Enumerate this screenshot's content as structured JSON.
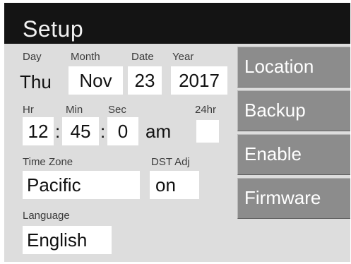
{
  "title": "Setup",
  "date": {
    "day_label": "Day",
    "month_label": "Month",
    "date_label": "Date",
    "year_label": "Year",
    "day": "Thu",
    "month": "Nov",
    "date": "23",
    "year": "2017"
  },
  "time": {
    "hr_label": "Hr",
    "min_label": "Min",
    "sec_label": "Sec",
    "h24_label": "24hr",
    "hr": "12",
    "min": "45",
    "sec": "0",
    "ampm": "am",
    "separator": ":",
    "h24_enabled": false
  },
  "timezone": {
    "label": "Time Zone",
    "value": "Pacific"
  },
  "dst": {
    "label": "DST Adj",
    "value": "on"
  },
  "language": {
    "label": "Language",
    "value": "English"
  },
  "side_buttons": [
    "Location",
    "Backup",
    "Enable",
    "Firmware"
  ],
  "colors": {
    "title_bar": "#141414",
    "panel": "#dddddd",
    "button": "#8c8c8c",
    "field": "#ffffff"
  }
}
